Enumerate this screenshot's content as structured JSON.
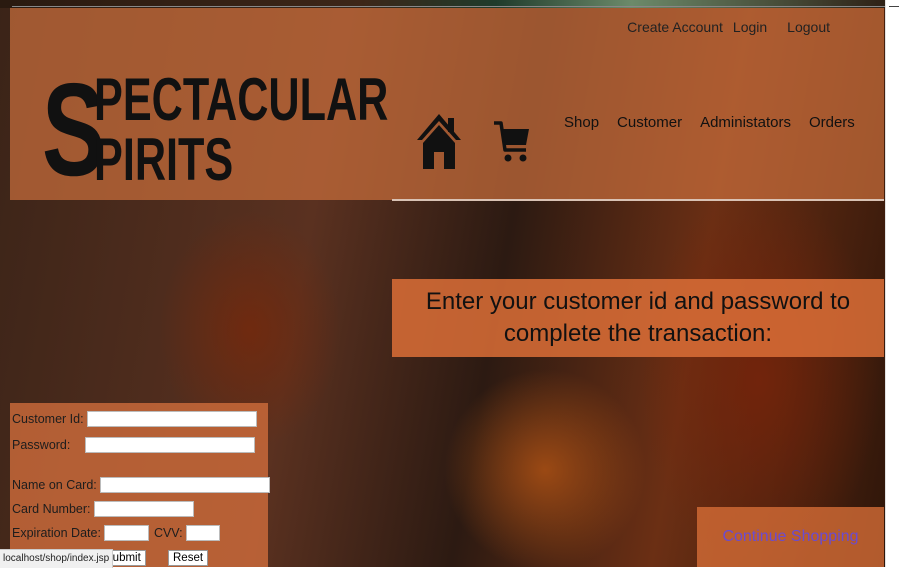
{
  "header": {
    "top_links": {
      "create_account": "Create Account",
      "login": "Login",
      "logout": "Logout"
    },
    "logo": {
      "initial": "S",
      "line1": "PECTACULAR",
      "line2": "PIRITS"
    },
    "nav": {
      "shop": "Shop",
      "customer": "Customer",
      "administrators": "Administators",
      "orders": "Orders"
    }
  },
  "banner": {
    "text": "Enter your customer id and password to complete the transaction:"
  },
  "form": {
    "customer_id_label": "Customer Id:",
    "customer_id_value": "",
    "password_label": "Password:",
    "password_value": "",
    "name_on_card_label": "Name on Card:",
    "name_on_card_value": "",
    "card_number_label": "Card Number:",
    "card_number_value": "",
    "expiration_label": "Expiration Date:",
    "expiration_value": "",
    "cvv_label": "CVV:",
    "cvv_value": "",
    "submit_label": "Submit",
    "reset_label": "Reset"
  },
  "continue_shopping": "Continue Shopping",
  "status_bar": {
    "url": "localhost/shop/index.jsp"
  },
  "colors": {
    "header_band": "#c86e3c",
    "link_purple": "#6b4bd0",
    "panel": "#d26e3c"
  },
  "icons": {
    "home": "home-icon",
    "cart": "cart-icon"
  }
}
